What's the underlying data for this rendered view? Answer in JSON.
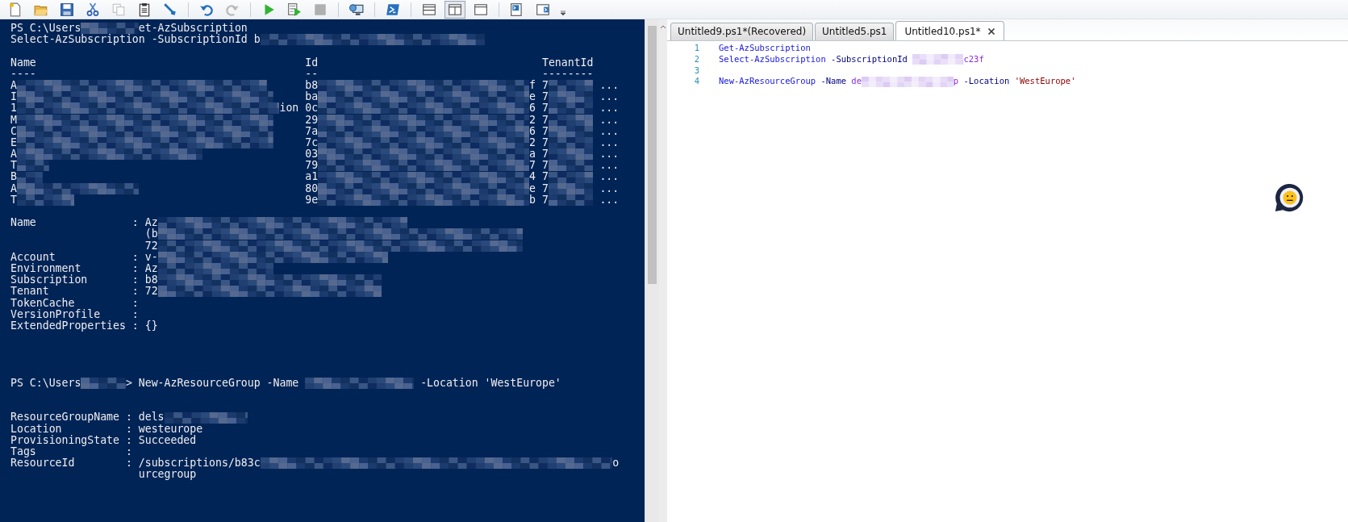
{
  "toolbar": {
    "groups": [
      [
        {
          "kind": "new",
          "disabled": false,
          "selected": false
        },
        {
          "kind": "open",
          "disabled": false,
          "selected": false
        },
        {
          "kind": "save",
          "disabled": false,
          "selected": false
        },
        {
          "kind": "cut",
          "disabled": false,
          "selected": false
        },
        {
          "kind": "copy",
          "disabled": true,
          "selected": false
        },
        {
          "kind": "paste",
          "disabled": false,
          "selected": false
        },
        {
          "kind": "clear",
          "disabled": false,
          "selected": false
        }
      ],
      [
        {
          "kind": "undo",
          "disabled": false,
          "selected": false
        },
        {
          "kind": "redo",
          "disabled": true,
          "selected": false
        }
      ],
      [
        {
          "kind": "run",
          "disabled": false,
          "selected": false
        },
        {
          "kind": "run-selection",
          "disabled": false,
          "selected": false
        },
        {
          "kind": "stop",
          "disabled": true,
          "selected": false
        }
      ],
      [
        {
          "kind": "remote",
          "disabled": false,
          "selected": false
        }
      ],
      [
        {
          "kind": "powershell",
          "disabled": false,
          "selected": false
        }
      ],
      [
        {
          "kind": "layout-top",
          "disabled": false,
          "selected": false
        },
        {
          "kind": "layout-right",
          "disabled": false,
          "selected": true
        },
        {
          "kind": "layout-max",
          "disabled": false,
          "selected": false
        }
      ],
      [
        {
          "kind": "show-script",
          "disabled": false,
          "selected": false
        },
        {
          "kind": "show-console",
          "disabled": false,
          "selected": false
        }
      ]
    ]
  },
  "console": {
    "command_1": {
      "prompt": "PS C:\\Users",
      "redacted": true,
      "command": "et-AzSubscription"
    },
    "command_1_next": {
      "text": "Select-AzSubscription -SubscriptionId b",
      "redacted": true
    },
    "subscriptions": {
      "columns": [
        "Name",
        "Id",
        "TenantId"
      ],
      "underlines": [
        "----",
        "--",
        "--------"
      ],
      "rows": [
        {
          "name": "A",
          "id_start": "b8",
          "id_end": "f",
          "tenant": "7",
          "more": "..."
        },
        {
          "name": "I",
          "id_start": "ba",
          "id_end": "e",
          "tenant": "7",
          "more": "..."
        },
        {
          "name": "1",
          "name_end": "ion",
          "id_start": "0c",
          "id_end": "6",
          "tenant": "7",
          "more": "..."
        },
        {
          "name": "M",
          "id_start": "29",
          "id_end": "2",
          "tenant": "7",
          "more": "..."
        },
        {
          "name": "C",
          "id_start": "7a",
          "id_end": "6",
          "tenant": "7",
          "more": "..."
        },
        {
          "name": "E",
          "id_start": "7c",
          "id_end": "2",
          "tenant": "7",
          "more": "..."
        },
        {
          "name": "A",
          "id_start": "03",
          "id_end": "a",
          "tenant": "7",
          "more": "..."
        },
        {
          "name": "T",
          "id_start": "79",
          "id_end": "7",
          "tenant": "7",
          "more": "..."
        },
        {
          "name": "B",
          "id_start": "a1",
          "id_end": "4",
          "tenant": "7",
          "more": "..."
        },
        {
          "name": "A",
          "id_start": "80",
          "id_end": "e",
          "tenant": "7",
          "more": "..."
        },
        {
          "name": "T",
          "id_start": "9e",
          "id_end": "b",
          "tenant": "7",
          "more": "..."
        }
      ]
    },
    "context": [
      {
        "key": "Name",
        "separator": ":",
        "values": [
          {
            "text": "Az",
            "redacted": true
          },
          {
            "text": "(b",
            "redacted": true
          },
          {
            "text": "72",
            "redacted": true
          }
        ]
      },
      {
        "key": "Account",
        "separator": ":",
        "values": [
          {
            "text": "v-",
            "redacted": true
          }
        ]
      },
      {
        "key": "Environment",
        "separator": ":",
        "values": [
          {
            "text": "Az",
            "redacted": true
          }
        ]
      },
      {
        "key": "Subscription",
        "separator": ":",
        "values": [
          {
            "text": "b8",
            "redacted": true
          }
        ]
      },
      {
        "key": "Tenant",
        "separator": ":",
        "values": [
          {
            "text": "72",
            "redacted": true
          }
        ]
      },
      {
        "key": "TokenCache",
        "separator": ":"
      },
      {
        "key": "VersionProfile",
        "separator": ":"
      },
      {
        "key": "ExtendedProperties",
        "separator": ":",
        "values": [
          {
            "text": "{}",
            "redacted": false
          }
        ]
      }
    ],
    "command_2": {
      "prompt": "PS C:\\Users",
      "redacted": true,
      "prompt_end": ">",
      "command": "New-AzResourceGroup -Name",
      "arguments": "-Location 'WestEurope'"
    },
    "resource_group": [
      {
        "key": "ResourceGroupName",
        "separator": ":",
        "values": [
          {
            "text": "dels",
            "redacted": true
          }
        ]
      },
      {
        "key": "Location",
        "separator": ":",
        "values": [
          {
            "text": "westeurope",
            "redacted": false
          }
        ]
      },
      {
        "key": "ProvisioningState",
        "separator": ":",
        "values": [
          {
            "text": "Succeeded",
            "redacted": false
          }
        ]
      },
      {
        "key": "Tags",
        "separator": ":"
      },
      {
        "key": "ResourceId",
        "separator": ":",
        "values": [
          {
            "text": "/subscriptions/b83c",
            "redacted": true,
            "tail": "o"
          },
          {
            "text": "urcegroup",
            "redacted": false
          }
        ]
      }
    ]
  },
  "editor": {
    "tabs": [
      {
        "label": "Untitled9.ps1*(Recovered)",
        "selected": false
      },
      {
        "label": "Untitled5.ps1",
        "selected": false
      },
      {
        "label": "Untitled10.ps1*",
        "selected": true
      }
    ],
    "lines": [
      {
        "number": "1",
        "tokens": [
          {
            "kind": "command",
            "text": "Get-AzSubscription"
          }
        ]
      },
      {
        "number": "2",
        "tokens": [
          {
            "kind": "command",
            "text": "Select-AzSubscription"
          },
          {
            "kind": "parameter",
            "text": "-SubscriptionId"
          },
          {
            "kind": "redacted"
          },
          {
            "kind": "argument",
            "text": "c23f"
          }
        ]
      },
      {
        "number": "3"
      },
      {
        "number": "4",
        "tokens": [
          {
            "kind": "command",
            "text": "New-AzResourceGroup"
          },
          {
            "kind": "parameter",
            "text": "-Name"
          },
          {
            "kind": "argument",
            "text": "de"
          },
          {
            "kind": "redacted"
          },
          {
            "kind": "argument",
            "text": "p"
          },
          {
            "kind": "parameter",
            "text": "-Location"
          },
          {
            "kind": "string",
            "text": "'WestEurope'"
          }
        ]
      }
    ]
  }
}
